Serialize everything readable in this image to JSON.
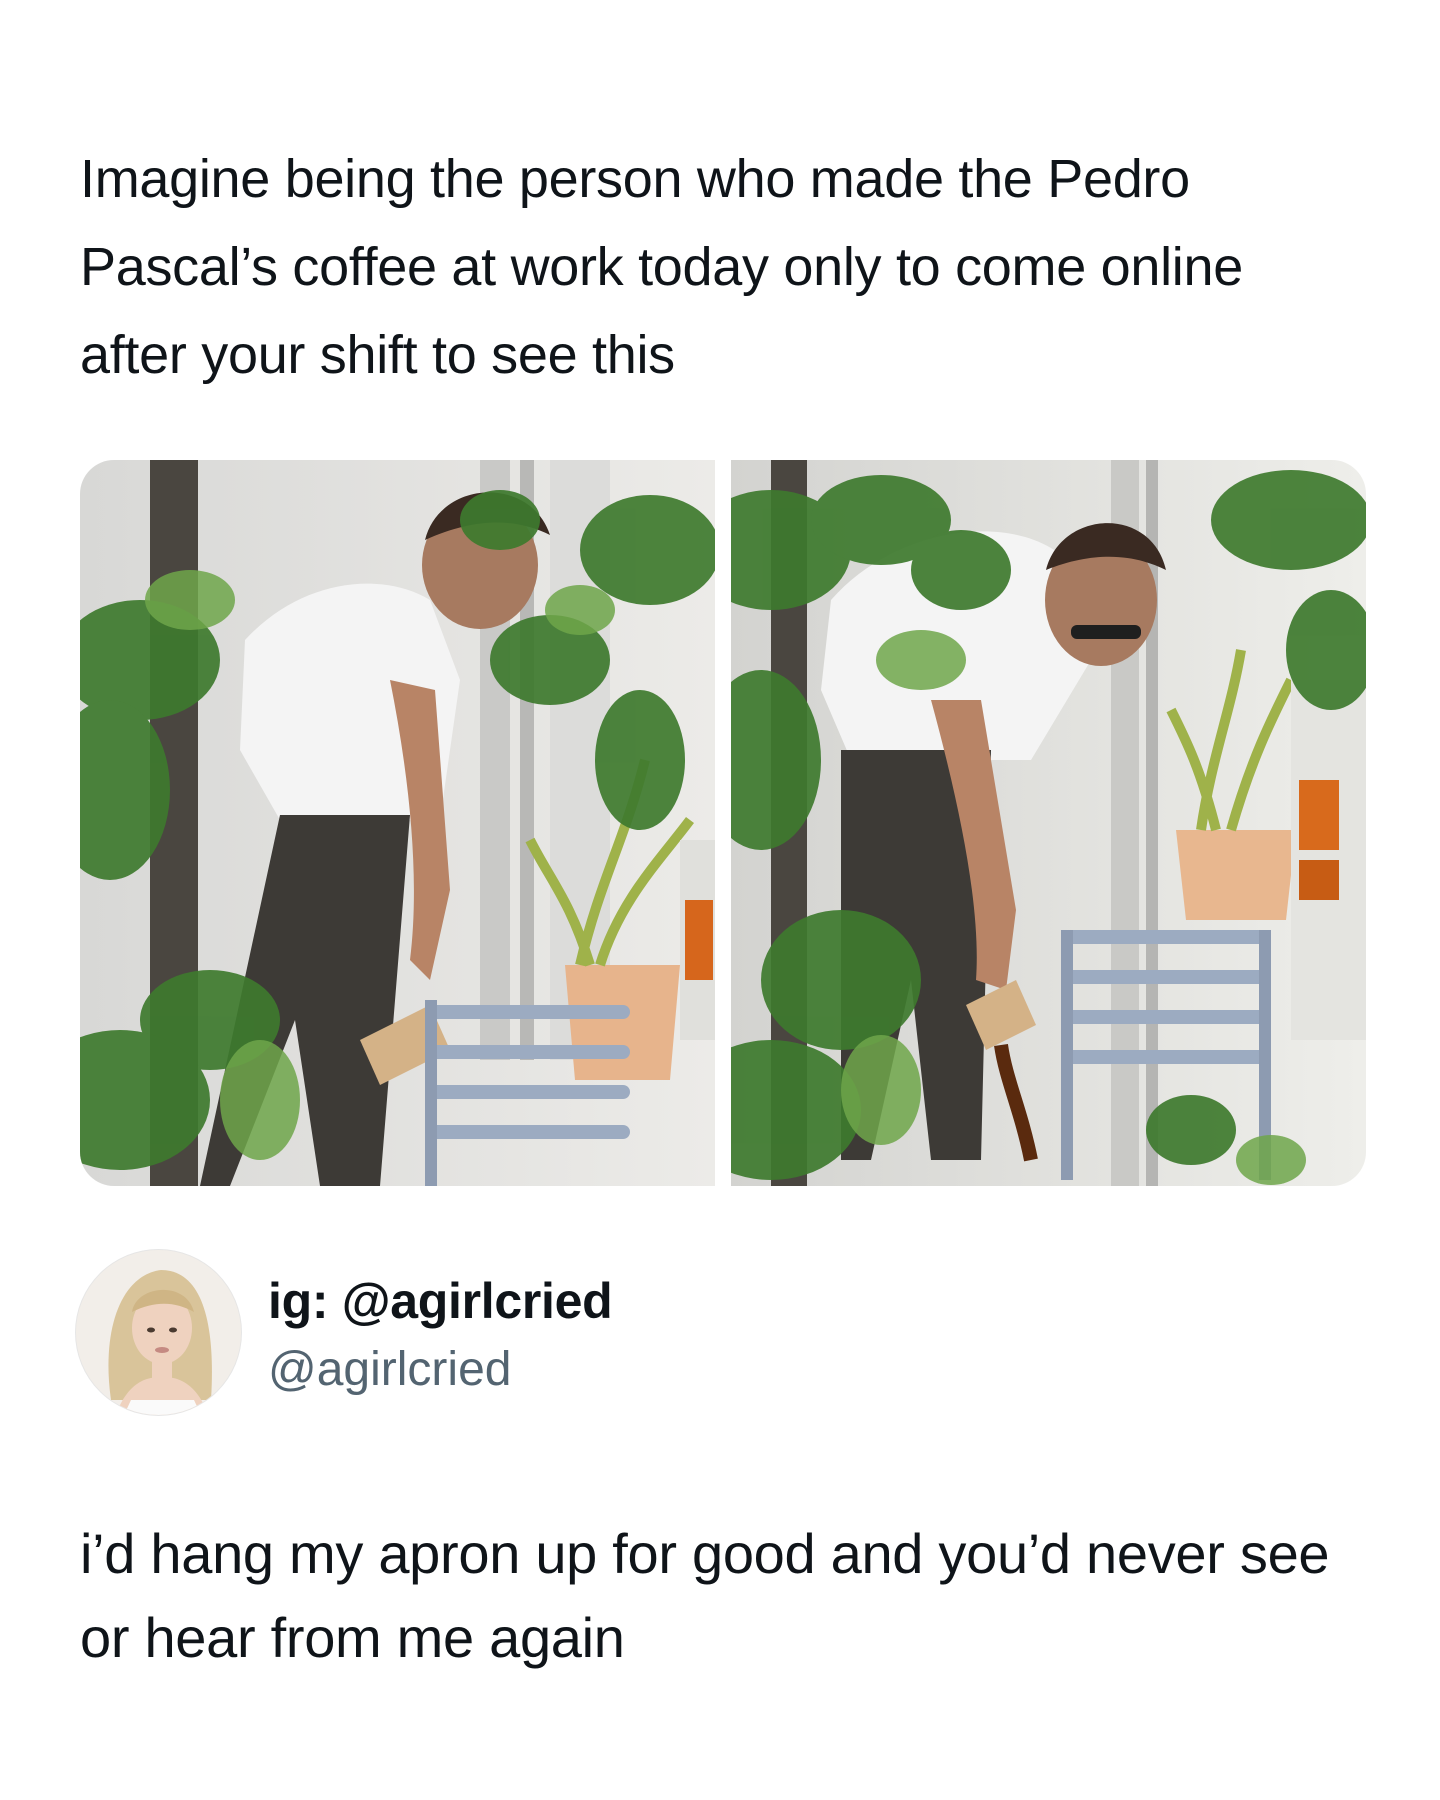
{
  "post": {
    "quoted_text": "Imagine being the person who made the Pedro Pascal’s coffee at work today only to come online after your shift to see this",
    "media": [
      {
        "name": "photo-left",
        "subject": "man holding cup"
      },
      {
        "name": "photo-right",
        "subject": "man pouring coffee"
      }
    ]
  },
  "author": {
    "display_name": "ig: @agirlcried",
    "handle": "@agirlcried",
    "avatar_icon": "profile-photo"
  },
  "reply": {
    "text": "i’d hang my apron up for good and you’d never see or hear from me again"
  },
  "colors": {
    "text": "#0f1419",
    "secondary": "#536471",
    "background": "#ffffff"
  }
}
